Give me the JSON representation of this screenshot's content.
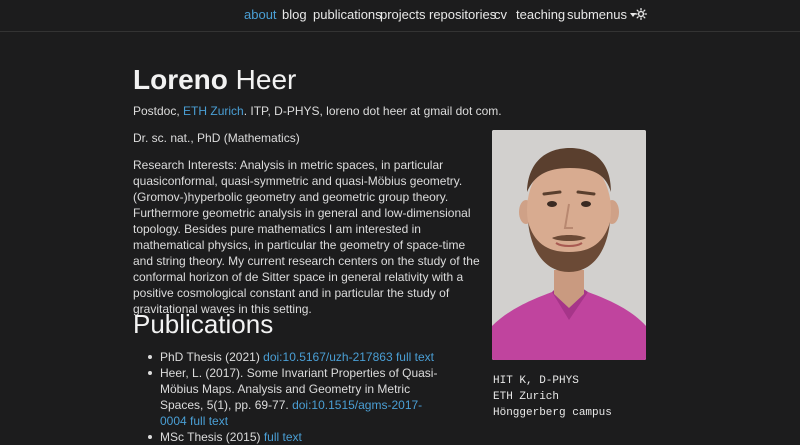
{
  "nav": {
    "items": [
      "about",
      "blog",
      "publications",
      "projects",
      "repositories",
      "cv",
      "teaching"
    ],
    "submenus_label": "submenus",
    "accent_color": "#4a9fd5"
  },
  "header": {
    "first_name": "Loreno",
    "last_name": "Heer"
  },
  "intro": {
    "prefix": "Postdoc, ",
    "org_link": "ETH Zurich",
    "suffix": ". ITP, D-PHYS, loreno dot heer at gmail dot com."
  },
  "degree": "Dr. sc. nat., PhD (Mathematics)",
  "research": "Research Interests: Analysis in metric spaces, in particular quasiconformal, quasi-symmetric and quasi-Möbius geometry. (Gromov-)hyperbolic geometry and geometric group theory. Furthermore geometric analysis in general and low-dimensional topology. Besides pure mathematics I am interested in mathematical physics, in particular the geometry of space-time and string theory. My current research centers on the study of the conformal horizon of de Sitter space in general relativity with a positive cosmological constant and in particular the study of gravitational waves in this setting.",
  "publications": {
    "heading": "Publications",
    "items": [
      {
        "text": "PhD Thesis (2021) ",
        "doi": "doi:10.5167/uzh-217863",
        "full": "full text"
      },
      {
        "text": "Heer, L. (2017). Some Invariant Properties of Quasi-Möbius Maps. Analysis and Geometry in Metric Spaces, 5(1), pp. 69-77. ",
        "doi": "doi:10.1515/agms-2017-0004",
        "full": "full text"
      },
      {
        "text": "MSc Thesis (2015) ",
        "doi": "",
        "full": "full text"
      }
    ]
  },
  "address": {
    "line1": "HIT K, D-PHYS",
    "line2": "ETH Zurich",
    "line3": "Hönggerberg campus"
  }
}
